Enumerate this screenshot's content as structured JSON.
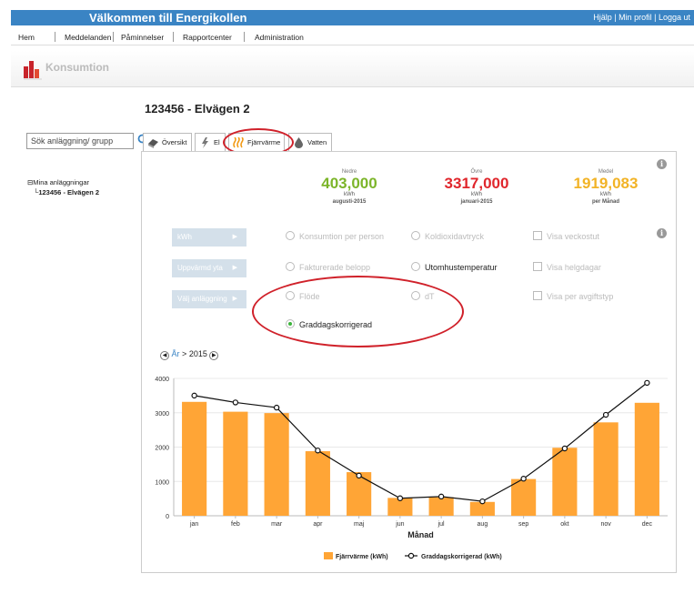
{
  "header": {
    "title": "Välkommen till Energikollen",
    "links": [
      "Hjälp",
      "Min profil",
      "Logga ut"
    ]
  },
  "menu": [
    "Hem",
    "Meddelanden",
    "Påminnelser",
    "Rapportcenter",
    "Administration"
  ],
  "section": {
    "label": "Konsumtion"
  },
  "page_title": "123456 - Elvägen 2",
  "search": {
    "placeholder": "Sök anläggning/ grupp"
  },
  "tree": {
    "root": "Mina anläggningar",
    "child": "123456 - Elvägen 2"
  },
  "tabs": [
    "Översikt",
    "El",
    "Fjärrvärme",
    "Vatten"
  ],
  "active_tab": "Fjärrvärme",
  "stats": {
    "low": {
      "label": "Nedre",
      "value": "403,000",
      "unit": "kWh",
      "period": "augusti-2015",
      "color": "#7cb52a"
    },
    "high": {
      "label": "Övre",
      "value": "3317,000",
      "unit": "kWh",
      "period": "januari-2015",
      "color": "#e0262c"
    },
    "mean": {
      "label": "Medel",
      "value": "1919,083",
      "unit": "kWh",
      "period": "per Månad",
      "color": "#f2b326"
    }
  },
  "side_buttons": [
    "kWh",
    "Uppvärmd yta",
    "Välj anläggning"
  ],
  "options": {
    "col1": [
      "Konsumtion per person",
      "Fakturerade belopp",
      "Flöde",
      "Graddagskorrigerad"
    ],
    "col2": [
      "Koldioxidavtryck",
      "Utomhustemperatur",
      "dT"
    ],
    "col3": [
      "Visa veckostut",
      "Visa helgdagar",
      "Visa per avgiftstyp"
    ]
  },
  "year_nav": {
    "level": "År",
    "sep": ">",
    "year": "2015"
  },
  "colors": {
    "accent": "#3a84c4",
    "bar": "#ffa536",
    "highlight": "#d0212a"
  },
  "chart_data": {
    "type": "bar",
    "categories": [
      "jan",
      "feb",
      "mar",
      "apr",
      "maj",
      "jun",
      "jul",
      "aug",
      "sep",
      "okt",
      "nov",
      "dec"
    ],
    "series": [
      {
        "name": "Fjärrvärme (kWh)",
        "type": "bar",
        "values": [
          3317,
          3030,
          2990,
          1880,
          1270,
          520,
          540,
          403,
          1070,
          1980,
          2720,
          3290
        ]
      },
      {
        "name": "Graddagskorrigerad (kWh)",
        "type": "line",
        "values": [
          3500,
          3300,
          3150,
          1900,
          1170,
          510,
          560,
          420,
          1080,
          1960,
          2940,
          3870
        ]
      }
    ],
    "xlabel": "Månad",
    "ylabel": "",
    "ylim": [
      0,
      4000
    ],
    "yticks": [
      0,
      1000,
      2000,
      3000,
      4000
    ],
    "grid": true,
    "legend": "bottom"
  }
}
